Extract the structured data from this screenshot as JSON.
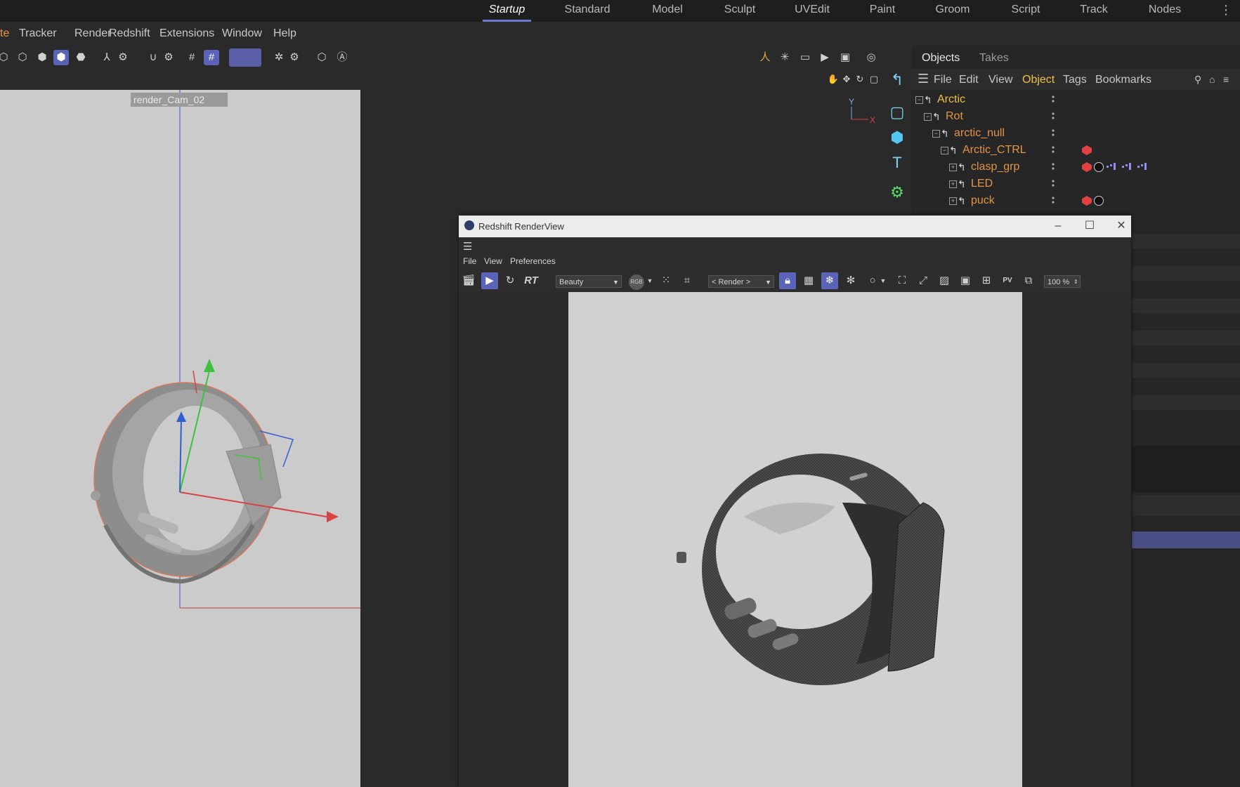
{
  "layout_tabs": [
    "Startup",
    "Standard",
    "Model",
    "Sculpt",
    "UVEdit",
    "Paint",
    "Groom",
    "Script",
    "Track",
    "Nodes"
  ],
  "active_layout": "Startup",
  "menu": [
    "te",
    "Tracker",
    "Render",
    "Redshift",
    "Extensions",
    "Window",
    "Help"
  ],
  "viewport": {
    "camera_label": "render_Cam_02",
    "axis_y": "Y",
    "axis_x": "X"
  },
  "objects_panel": {
    "tabs": [
      "Objects",
      "Takes"
    ],
    "menu": [
      "File",
      "Edit",
      "View",
      "Object",
      "Tags",
      "Bookmarks"
    ],
    "active_menu": "Object",
    "items": [
      {
        "name": "Arctic"
      },
      {
        "name": "Rot"
      },
      {
        "name": "arctic_null"
      },
      {
        "name": "Arctic_CTRL"
      },
      {
        "name": "clasp_grp"
      },
      {
        "name": "LED"
      },
      {
        "name": "puck"
      }
    ]
  },
  "renderview": {
    "title": "Redshift RenderView",
    "menu": [
      "File",
      "View",
      "Preferences"
    ],
    "rt_label": "RT",
    "aov": "Beauty",
    "rgb_label": "RGB",
    "camera": "< Render >",
    "zoom": "100 %",
    "pv_label": "PV"
  },
  "colors": {
    "accent": "#5a63b8",
    "object_name": "#e39545",
    "object_root": "#f0c040"
  }
}
